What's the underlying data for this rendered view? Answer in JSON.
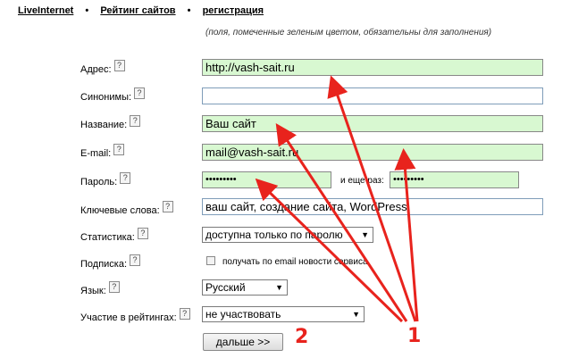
{
  "nav": {
    "items": [
      "LiveInternet",
      "Рейтинг сайтов",
      "регистрация"
    ],
    "separator": "•"
  },
  "note": "(поля, помеченные зеленым цветом, обязательны для заполнения)",
  "help_glyph": "?",
  "form": {
    "address": {
      "label": "Адрес:",
      "value": "http://vash-sait.ru"
    },
    "synonyms": {
      "label": "Синонимы:",
      "value": ""
    },
    "name": {
      "label": "Название:",
      "value": "Ваш сайт"
    },
    "email": {
      "label": "E-mail:",
      "value": "mail@vash-sait.ru"
    },
    "password": {
      "label": "Пароль:",
      "value": "•••••••••",
      "again_label": "и еще раз:",
      "again_value": "•••••••••"
    },
    "keywords": {
      "label": "Ключевые слова:",
      "value": "ваш сайт, создание сайта, WordPress"
    },
    "statistics": {
      "label": "Статистика:",
      "selected": "доступна только по паролю"
    },
    "subscription": {
      "label": "Подписка:",
      "checkbox_label": "получать по email новости сервиса",
      "checked": false
    },
    "language": {
      "label": "Язык:",
      "selected": "Русский"
    },
    "ratings": {
      "label": "Участие в рейтингах:",
      "selected": "не участвовать"
    },
    "submit_label": "дальше >>"
  },
  "annotations": {
    "label_1": "1",
    "label_2": "2",
    "color": "#e8231d"
  },
  "colors": {
    "required_field_bg": "#d8f8d1"
  }
}
